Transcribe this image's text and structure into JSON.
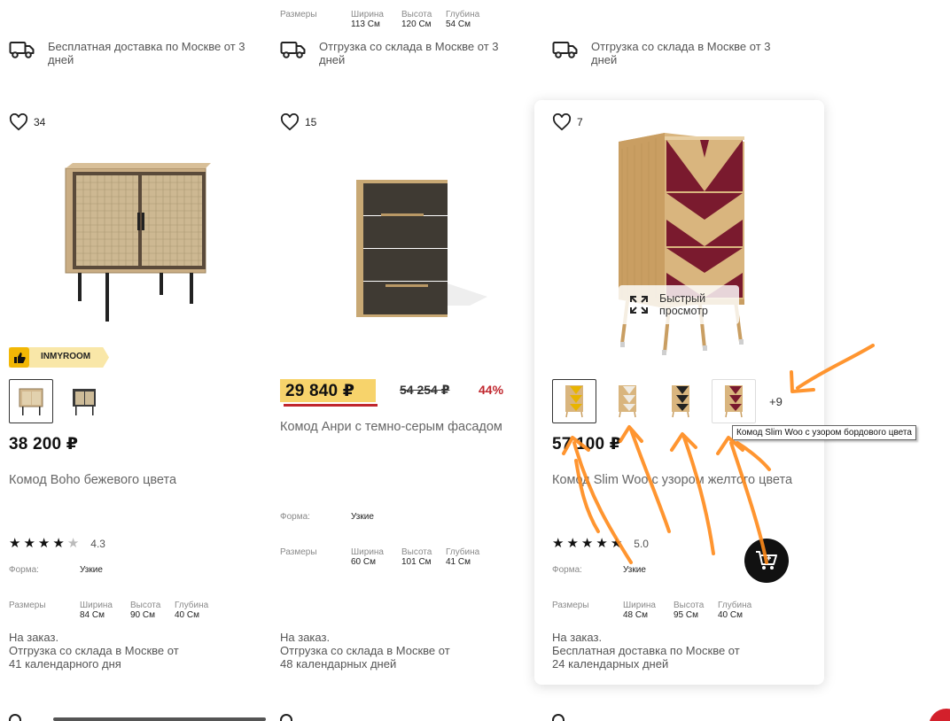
{
  "top_row": [
    {
      "delivery": "Бесплатная доставка по Москве от 3 дней"
    },
    {
      "sizes_label": "Размеры",
      "dims": [
        [
          "Ширина",
          "113 См"
        ],
        [
          "Высота",
          "120 См"
        ],
        [
          "Глубина",
          "54 См"
        ]
      ],
      "delivery": "Отгрузка со склада в Москве от 3 дней"
    },
    {
      "delivery": "Отгрузка со склада в Москве от 3 дней"
    }
  ],
  "products": [
    {
      "likes": "34",
      "badge": "INMYROOM",
      "price": "38 200 ₽",
      "title": "Комод Boho бежевого цвета",
      "rating": "4.3",
      "form_label": "Форма:",
      "form_value": "Узкие",
      "sizes_label": "Размеры",
      "dims": [
        [
          "Ширина",
          "84 См"
        ],
        [
          "Высота",
          "90 См"
        ],
        [
          "Глубина",
          "40 См"
        ]
      ],
      "order_lines": [
        "На заказ.",
        "Отгрузка со склада в Москве от",
        "41 календарного дня"
      ]
    },
    {
      "likes": "15",
      "price": "29 840 ₽",
      "old_price": "54 254 ₽",
      "discount": "44%",
      "title": "Комод Анри с темно-серым фасадом",
      "form_label": "Форма:",
      "form_value": "Узкие",
      "sizes_label": "Размеры",
      "dims": [
        [
          "Ширина",
          "60 См"
        ],
        [
          "Высота",
          "101 См"
        ],
        [
          "Глубина",
          "41 См"
        ]
      ],
      "order_lines": [
        "На заказ.",
        "Отгрузка со склада в Москве от",
        "48 календарных дней"
      ]
    },
    {
      "likes": "7",
      "quick_view": "Быстрый просмотр",
      "more_variants": "+9",
      "tooltip": "Комод Slim Woo с узором бордового цвета",
      "price": "57 100 ₽",
      "title": "Комод Slim Woo с узором желтого цвета",
      "rating": "5.0",
      "form_label": "Форма:",
      "form_value": "Узкие",
      "sizes_label": "Размеры",
      "dims": [
        [
          "Ширина",
          "48 См"
        ],
        [
          "Высота",
          "95 См"
        ],
        [
          "Глубина",
          "40 См"
        ]
      ],
      "order_lines": [
        "На заказ.",
        "Бесплатная доставка по Москве от",
        "24 календарных дней"
      ]
    }
  ],
  "colors": {
    "accent_price_bg": "#f7d36b",
    "discount_red": "#c0262d",
    "badge_bg": "#f7c948",
    "arrow_orange": "#ff8a1a",
    "cart_bg": "#111111"
  }
}
